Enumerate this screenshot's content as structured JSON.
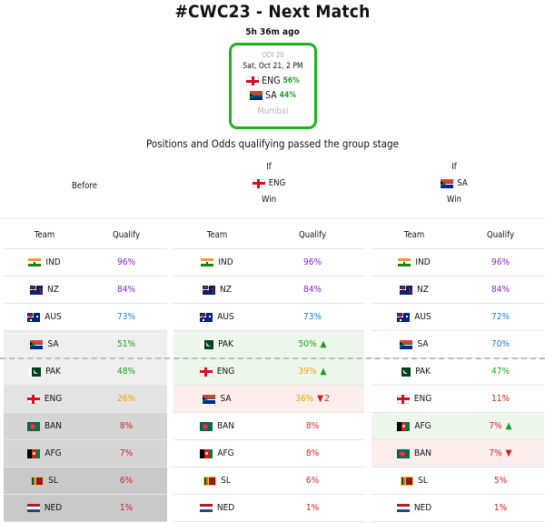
{
  "header": {
    "title": "#CWC23 - Next Match",
    "time_ago": "5h 36m ago"
  },
  "match": {
    "label": "ODI 20",
    "date": "Sat, Oct 21, 2 PM",
    "team1": "ENG",
    "team1_pct": "56%",
    "team2": "SA",
    "team2_pct": "44%",
    "venue": "Mumbai"
  },
  "subtitle": "Positions and Odds qualifying passed the group stage",
  "scenarios": {
    "before": "Before",
    "if_label": "If",
    "win_label": "Win",
    "team1": "ENG",
    "team2": "SA"
  },
  "columns": {
    "team": "Team",
    "qualify": "Qualify"
  },
  "colors": {
    "purple": "#8b1fd1",
    "blue": "#1d7fc9",
    "green": "#17a317",
    "orange": "#f2a100",
    "red": "#d42020",
    "row_green": "#eef7ec",
    "row_red": "#fdeeee",
    "grey1": "#efefef",
    "grey2": "#e3e3e3",
    "grey3": "#d5d5d5",
    "grey4": "#c9c9c9"
  },
  "tables": [
    {
      "rows": [
        {
          "team": "IND",
          "flag": "ind",
          "qualify": "96%",
          "color": "purple",
          "bg": ""
        },
        {
          "team": "NZ",
          "flag": "nz",
          "qualify": "84%",
          "color": "purple",
          "bg": ""
        },
        {
          "team": "AUS",
          "flag": "aus",
          "qualify": "73%",
          "color": "blue",
          "bg": ""
        },
        {
          "team": "SA",
          "flag": "sa",
          "qualify": "51%",
          "color": "green",
          "bg": "grey1"
        },
        {
          "team": "PAK",
          "flag": "pak",
          "qualify": "48%",
          "color": "green",
          "bg": "grey1"
        },
        {
          "team": "ENG",
          "flag": "eng",
          "qualify": "26%",
          "color": "orange",
          "bg": "grey2"
        },
        {
          "team": "BAN",
          "flag": "ban",
          "qualify": "8%",
          "color": "red",
          "bg": "grey3"
        },
        {
          "team": "AFG",
          "flag": "afg",
          "qualify": "7%",
          "color": "red",
          "bg": "grey3"
        },
        {
          "team": "SL",
          "flag": "sl",
          "qualify": "6%",
          "color": "red",
          "bg": "grey4"
        },
        {
          "team": "NED",
          "flag": "ned",
          "qualify": "1%",
          "color": "red",
          "bg": "grey4"
        }
      ]
    },
    {
      "rows": [
        {
          "team": "IND",
          "flag": "ind",
          "qualify": "96%",
          "color": "purple",
          "bg": ""
        },
        {
          "team": "NZ",
          "flag": "nz",
          "qualify": "84%",
          "color": "purple",
          "bg": ""
        },
        {
          "team": "AUS",
          "flag": "aus",
          "qualify": "73%",
          "color": "blue",
          "bg": ""
        },
        {
          "team": "PAK",
          "flag": "pak",
          "qualify": "50%",
          "color": "green",
          "bg": "row_green",
          "move": "up",
          "move_text": ""
        },
        {
          "team": "ENG",
          "flag": "eng",
          "qualify": "39%",
          "color": "orange",
          "bg": "row_green",
          "move": "up",
          "move_text": ""
        },
        {
          "team": "SA",
          "flag": "sa",
          "qualify": "36%",
          "color": "orange",
          "bg": "row_red",
          "move": "down",
          "move_text": "2"
        },
        {
          "team": "BAN",
          "flag": "ban",
          "qualify": "8%",
          "color": "red",
          "bg": ""
        },
        {
          "team": "AFG",
          "flag": "afg",
          "qualify": "8%",
          "color": "red",
          "bg": ""
        },
        {
          "team": "SL",
          "flag": "sl",
          "qualify": "6%",
          "color": "red",
          "bg": ""
        },
        {
          "team": "NED",
          "flag": "ned",
          "qualify": "1%",
          "color": "red",
          "bg": ""
        }
      ]
    },
    {
      "rows": [
        {
          "team": "IND",
          "flag": "ind",
          "qualify": "96%",
          "color": "purple",
          "bg": ""
        },
        {
          "team": "NZ",
          "flag": "nz",
          "qualify": "84%",
          "color": "purple",
          "bg": ""
        },
        {
          "team": "AUS",
          "flag": "aus",
          "qualify": "72%",
          "color": "blue",
          "bg": ""
        },
        {
          "team": "SA",
          "flag": "sa",
          "qualify": "70%",
          "color": "blue",
          "bg": ""
        },
        {
          "team": "PAK",
          "flag": "pak",
          "qualify": "47%",
          "color": "green",
          "bg": ""
        },
        {
          "team": "ENG",
          "flag": "eng",
          "qualify": "11%",
          "color": "red",
          "bg": ""
        },
        {
          "team": "AFG",
          "flag": "afg",
          "qualify": "7%",
          "color": "red",
          "bg": "row_green",
          "move": "up",
          "move_text": ""
        },
        {
          "team": "BAN",
          "flag": "ban",
          "qualify": "7%",
          "color": "red",
          "bg": "row_red",
          "move": "down",
          "move_text": ""
        },
        {
          "team": "SL",
          "flag": "sl",
          "qualify": "5%",
          "color": "red",
          "bg": ""
        },
        {
          "team": "NED",
          "flag": "ned",
          "qualify": "1%",
          "color": "red",
          "bg": ""
        }
      ]
    }
  ]
}
